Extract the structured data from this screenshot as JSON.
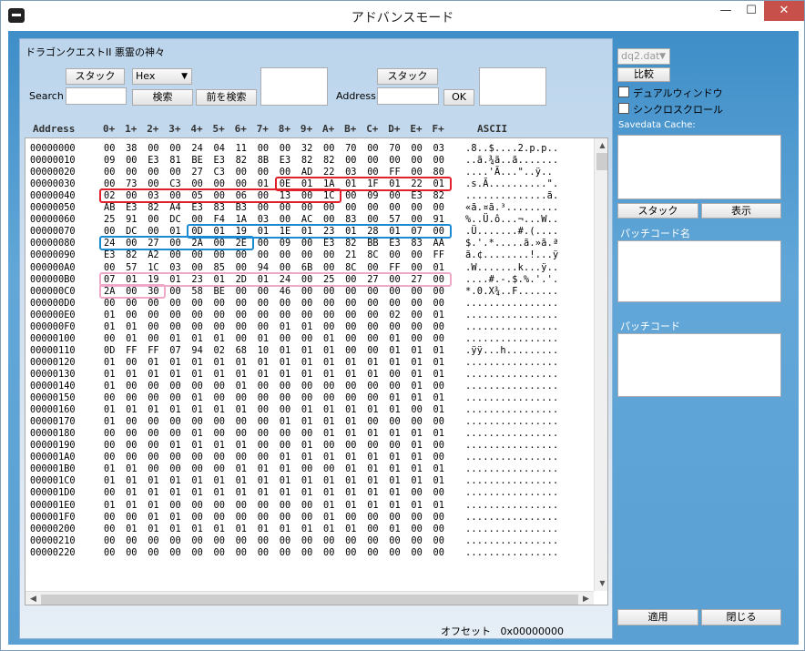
{
  "window": {
    "title": "アドバンスモード",
    "min": "—",
    "max": "☐",
    "close": "✕"
  },
  "game_title": "ドラゴンクエストII 悪霊の神々",
  "search": {
    "label": "Search",
    "stack_button": "スタック",
    "type_select": "Hex",
    "search_button": "検索",
    "prev_button": "前を検索"
  },
  "address": {
    "label": "Address",
    "stack_button": "スタック",
    "ok_button": "OK"
  },
  "hex_header": {
    "address": "Address",
    "cols": [
      "0+",
      "1+",
      "2+",
      "3+",
      "4+",
      "5+",
      "6+",
      "7+",
      "8+",
      "9+",
      "A+",
      "B+",
      "C+",
      "D+",
      "E+",
      "F+"
    ],
    "ascii": "ASCII"
  },
  "rows": [
    {
      "addr": "00000000",
      "hex": [
        "00",
        "38",
        "00",
        "00",
        "24",
        "04",
        "11",
        "00",
        "00",
        "32",
        "00",
        "70",
        "00",
        "70",
        "00",
        "03"
      ],
      "ascii": ".8..$....2.p.p.."
    },
    {
      "addr": "00000010",
      "hex": [
        "09",
        "00",
        "E3",
        "81",
        "BE",
        "E3",
        "82",
        "8B",
        "E3",
        "82",
        "82",
        "00",
        "00",
        "00",
        "00",
        "00"
      ],
      "ascii": "..ã.¾ã..ã......."
    },
    {
      "addr": "00000020",
      "hex": [
        "00",
        "00",
        "00",
        "00",
        "27",
        "C3",
        "00",
        "00",
        "00",
        "AD",
        "22",
        "03",
        "00",
        "FF",
        "00",
        "80"
      ],
      "ascii": "....'Ã...\"..ÿ.."
    },
    {
      "addr": "00000030",
      "hex": [
        "00",
        "73",
        "00",
        "C3",
        "00",
        "00",
        "00",
        "01",
        "0E",
        "01",
        "1A",
        "01",
        "1F",
        "01",
        "22",
        "01"
      ],
      "ascii": ".s.Ã..........\"."
    },
    {
      "addr": "00000040",
      "hex": [
        "02",
        "00",
        "03",
        "00",
        "05",
        "00",
        "06",
        "00",
        "13",
        "00",
        "1C",
        "00",
        "09",
        "00",
        "E3",
        "82"
      ],
      "ascii": "..............ã."
    },
    {
      "addr": "00000050",
      "hex": [
        "AB",
        "E3",
        "82",
        "A4",
        "E3",
        "83",
        "B3",
        "00",
        "00",
        "00",
        "00",
        "00",
        "00",
        "00",
        "00",
        "00"
      ],
      "ascii": "«ã.¤ã.³........."
    },
    {
      "addr": "00000060",
      "hex": [
        "25",
        "91",
        "00",
        "DC",
        "00",
        "F4",
        "1A",
        "03",
        "00",
        "AC",
        "00",
        "83",
        "00",
        "57",
        "00",
        "91"
      ],
      "ascii": "%..Ü.ô...¬...W.."
    },
    {
      "addr": "00000070",
      "hex": [
        "00",
        "DC",
        "00",
        "01",
        "0D",
        "01",
        "19",
        "01",
        "1E",
        "01",
        "23",
        "01",
        "28",
        "01",
        "07",
        "00"
      ],
      "ascii": ".Ü.......#.(...."
    },
    {
      "addr": "00000080",
      "hex": [
        "24",
        "00",
        "27",
        "00",
        "2A",
        "00",
        "2E",
        "00",
        "09",
        "00",
        "E3",
        "82",
        "BB",
        "E3",
        "83",
        "AA"
      ],
      "ascii": "$.'.*.....ã.»ã.ª"
    },
    {
      "addr": "00000090",
      "hex": [
        "E3",
        "82",
        "A2",
        "00",
        "00",
        "00",
        "00",
        "00",
        "00",
        "00",
        "00",
        "21",
        "8C",
        "00",
        "00",
        "FF"
      ],
      "ascii": "ã.¢........!...ÿ"
    },
    {
      "addr": "000000A0",
      "hex": [
        "00",
        "57",
        "1C",
        "03",
        "00",
        "85",
        "00",
        "94",
        "00",
        "6B",
        "00",
        "8C",
        "00",
        "FF",
        "00",
        "01"
      ],
      "ascii": ".W.......k...ÿ.."
    },
    {
      "addr": "000000B0",
      "hex": [
        "07",
        "01",
        "19",
        "01",
        "23",
        "01",
        "2D",
        "01",
        "24",
        "00",
        "25",
        "00",
        "27",
        "00",
        "27",
        "00"
      ],
      "ascii": "....#.-.$.%.'.'."
    },
    {
      "addr": "000000C0",
      "hex": [
        "2A",
        "00",
        "30",
        "00",
        "58",
        "BE",
        "00",
        "00",
        "46",
        "00",
        "00",
        "00",
        "00",
        "00",
        "00",
        "00"
      ],
      "ascii": "*.0.X¾..F......."
    },
    {
      "addr": "000000D0",
      "hex": [
        "00",
        "00",
        "00",
        "00",
        "00",
        "00",
        "00",
        "00",
        "00",
        "00",
        "00",
        "00",
        "00",
        "00",
        "00",
        "00"
      ],
      "ascii": "................"
    },
    {
      "addr": "000000E0",
      "hex": [
        "01",
        "00",
        "00",
        "00",
        "00",
        "00",
        "00",
        "00",
        "00",
        "00",
        "00",
        "00",
        "00",
        "02",
        "00",
        "01"
      ],
      "ascii": "................"
    },
    {
      "addr": "000000F0",
      "hex": [
        "01",
        "01",
        "00",
        "00",
        "00",
        "00",
        "00",
        "00",
        "01",
        "01",
        "00",
        "00",
        "00",
        "00",
        "00",
        "00"
      ],
      "ascii": "................"
    },
    {
      "addr": "00000100",
      "hex": [
        "00",
        "01",
        "00",
        "01",
        "01",
        "01",
        "00",
        "01",
        "00",
        "00",
        "01",
        "00",
        "00",
        "01",
        "00",
        "00"
      ],
      "ascii": "................"
    },
    {
      "addr": "00000110",
      "hex": [
        "0D",
        "FF",
        "FF",
        "07",
        "94",
        "02",
        "68",
        "10",
        "01",
        "01",
        "01",
        "00",
        "00",
        "01",
        "01",
        "01"
      ],
      "ascii": ".ÿÿ...h........."
    },
    {
      "addr": "00000120",
      "hex": [
        "01",
        "00",
        "01",
        "01",
        "01",
        "01",
        "01",
        "01",
        "01",
        "01",
        "01",
        "01",
        "01",
        "01",
        "01",
        "01"
      ],
      "ascii": "................"
    },
    {
      "addr": "00000130",
      "hex": [
        "01",
        "01",
        "01",
        "01",
        "01",
        "01",
        "01",
        "01",
        "01",
        "01",
        "01",
        "01",
        "01",
        "00",
        "01",
        "01"
      ],
      "ascii": "................"
    },
    {
      "addr": "00000140",
      "hex": [
        "01",
        "00",
        "00",
        "00",
        "00",
        "00",
        "01",
        "00",
        "00",
        "00",
        "00",
        "00",
        "00",
        "00",
        "01",
        "00"
      ],
      "ascii": "................"
    },
    {
      "addr": "00000150",
      "hex": [
        "00",
        "00",
        "00",
        "00",
        "01",
        "00",
        "00",
        "00",
        "00",
        "00",
        "00",
        "00",
        "00",
        "01",
        "01",
        "01"
      ],
      "ascii": "................"
    },
    {
      "addr": "00000160",
      "hex": [
        "01",
        "01",
        "01",
        "01",
        "01",
        "01",
        "01",
        "00",
        "00",
        "01",
        "01",
        "01",
        "01",
        "01",
        "00",
        "01"
      ],
      "ascii": "................"
    },
    {
      "addr": "00000170",
      "hex": [
        "01",
        "00",
        "00",
        "00",
        "00",
        "00",
        "00",
        "00",
        "01",
        "01",
        "01",
        "01",
        "00",
        "00",
        "00",
        "00"
      ],
      "ascii": "................"
    },
    {
      "addr": "00000180",
      "hex": [
        "00",
        "00",
        "00",
        "00",
        "01",
        "00",
        "00",
        "00",
        "00",
        "00",
        "01",
        "01",
        "01",
        "01",
        "01",
        "01"
      ],
      "ascii": "................"
    },
    {
      "addr": "00000190",
      "hex": [
        "00",
        "00",
        "00",
        "01",
        "01",
        "01",
        "01",
        "00",
        "00",
        "01",
        "00",
        "00",
        "00",
        "00",
        "01",
        "00"
      ],
      "ascii": "................"
    },
    {
      "addr": "000001A0",
      "hex": [
        "00",
        "00",
        "00",
        "00",
        "00",
        "00",
        "00",
        "00",
        "01",
        "01",
        "01",
        "01",
        "01",
        "01",
        "01",
        "00"
      ],
      "ascii": "................"
    },
    {
      "addr": "000001B0",
      "hex": [
        "01",
        "01",
        "00",
        "00",
        "00",
        "00",
        "01",
        "01",
        "01",
        "00",
        "00",
        "01",
        "01",
        "01",
        "01",
        "01"
      ],
      "ascii": "................"
    },
    {
      "addr": "000001C0",
      "hex": [
        "01",
        "01",
        "01",
        "01",
        "01",
        "01",
        "01",
        "01",
        "01",
        "01",
        "01",
        "01",
        "01",
        "01",
        "01",
        "01"
      ],
      "ascii": "................"
    },
    {
      "addr": "000001D0",
      "hex": [
        "00",
        "01",
        "01",
        "01",
        "01",
        "01",
        "01",
        "01",
        "01",
        "01",
        "01",
        "01",
        "01",
        "01",
        "00",
        "00"
      ],
      "ascii": "................"
    },
    {
      "addr": "000001E0",
      "hex": [
        "01",
        "01",
        "01",
        "00",
        "00",
        "00",
        "00",
        "00",
        "00",
        "00",
        "01",
        "01",
        "01",
        "01",
        "01",
        "01"
      ],
      "ascii": "................"
    },
    {
      "addr": "000001F0",
      "hex": [
        "00",
        "00",
        "01",
        "01",
        "00",
        "00",
        "00",
        "00",
        "00",
        "00",
        "01",
        "00",
        "00",
        "00",
        "00",
        "00"
      ],
      "ascii": "................"
    },
    {
      "addr": "00000200",
      "hex": [
        "00",
        "01",
        "01",
        "01",
        "01",
        "01",
        "01",
        "01",
        "01",
        "01",
        "01",
        "01",
        "00",
        "01",
        "00",
        "00"
      ],
      "ascii": "................"
    },
    {
      "addr": "00000210",
      "hex": [
        "00",
        "00",
        "00",
        "00",
        "00",
        "00",
        "00",
        "00",
        "00",
        "00",
        "00",
        "00",
        "00",
        "00",
        "00",
        "00"
      ],
      "ascii": "................"
    },
    {
      "addr": "00000220",
      "hex": [
        "00",
        "00",
        "00",
        "00",
        "00",
        "00",
        "00",
        "00",
        "00",
        "00",
        "00",
        "00",
        "00",
        "00",
        "00",
        "00"
      ],
      "ascii": "................"
    }
  ],
  "sidebar": {
    "file_select": "dq2.dat",
    "compare_button": "比較",
    "dual_window": "デュアルウィンドウ",
    "sync_scroll": "シンクロスクロール",
    "savedata_cache": "Savedata Cache:",
    "stack_button": "スタック",
    "show_button": "表示",
    "patch_name": "パッチコード名",
    "patch_code": "パッチコード",
    "apply_button": "適用",
    "close_button": "閉じる"
  },
  "offset": {
    "label": "オフセット",
    "value": "0x00000000"
  },
  "highlight_colors": {
    "red": "#e0202a",
    "blue": "#1a8ad4",
    "pink": "#f0a8c8"
  },
  "icons": {
    "dropdown": "▼",
    "scroll_up": "▲",
    "scroll_down": "▼",
    "scroll_left": "◀",
    "scroll_right": "▶"
  }
}
